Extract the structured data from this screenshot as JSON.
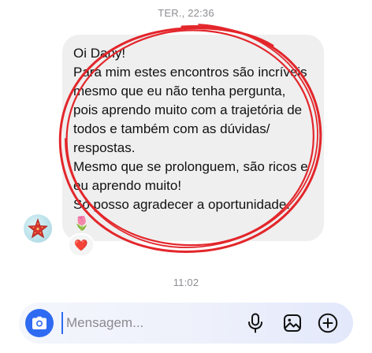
{
  "thread": {
    "top_timestamp": "TER., 22:36",
    "bottom_timestamp": "11:02"
  },
  "message": {
    "text": "Oi Dany!\nPara mim estes encontros são incríveis mesmo que eu não tenha pergunta, pois aprendo muito com a trajetória de todos e também com as dúvidas/ respostas.\nMesmo que se prolonguem, são ricos e eu aprendo muito!\nSó posso agradecer a oportunidade.",
    "emoji": "🌷",
    "reaction": "❤️"
  },
  "sender": {
    "avatar_icon": "starfish-icon"
  },
  "annotation": {
    "color": "#e3262b"
  },
  "composer": {
    "placeholder": "Mensagem...",
    "accent_color": "#2f6bf2",
    "icons": [
      "camera-icon",
      "microphone-icon",
      "gallery-icon",
      "plus-circle-icon"
    ]
  }
}
